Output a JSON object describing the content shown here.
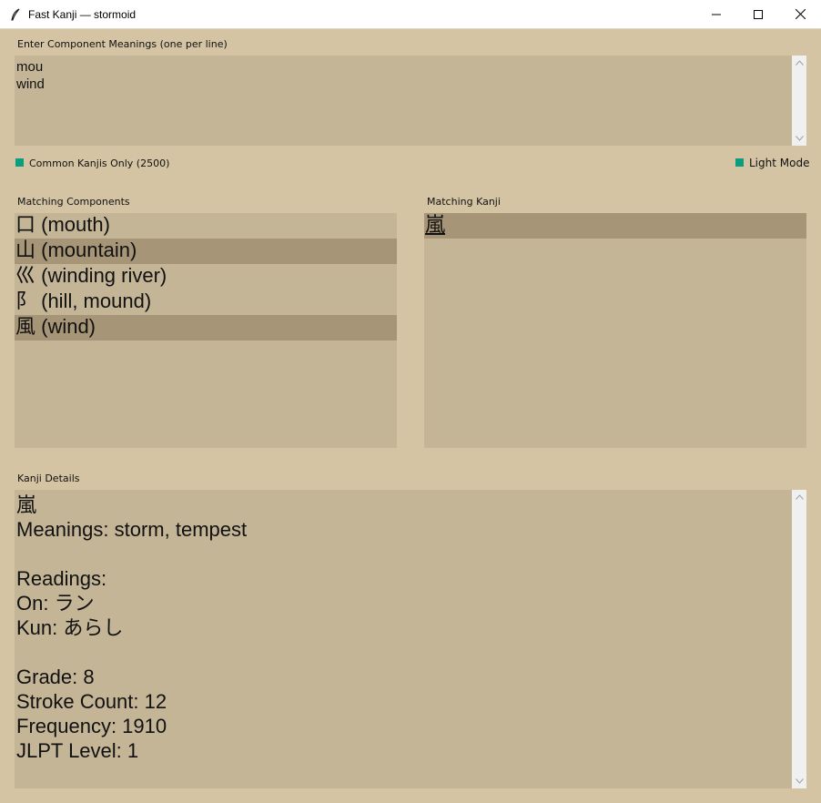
{
  "window": {
    "title": "Fast Kanji — stormoid"
  },
  "input_section": {
    "label": "Enter Component Meanings (one per line)",
    "text": "mou\nwind"
  },
  "options": {
    "common_only_label": "Common Kanjis Only (2500)",
    "light_mode_label": "Light Mode",
    "check_color": "#0a9e7e"
  },
  "components": {
    "label": "Matching Components",
    "items": [
      {
        "text": "口 (mouth)",
        "selected": false
      },
      {
        "text": "山 (mountain)",
        "selected": true
      },
      {
        "text": "巛 (winding river)",
        "selected": false
      },
      {
        "text": "阝 (hill, mound)",
        "selected": false
      },
      {
        "text": "風 (wind)",
        "selected": true
      }
    ]
  },
  "kanji_list": {
    "label": "Matching Kanji",
    "items": [
      {
        "text": "嵐",
        "selected": true
      }
    ]
  },
  "details": {
    "label": "Kanji Details",
    "lines": [
      "嵐",
      "Meanings: storm, tempest",
      "",
      "Readings:",
      "On: ラン",
      "Kun: あらし",
      "",
      "Grade: 8",
      "Stroke Count: 12",
      "Frequency: 1910",
      "JLPT Level: 1"
    ]
  },
  "colors": {
    "background": "#d4c4a4",
    "panel": "#c4b596",
    "selection": "#a69576"
  }
}
